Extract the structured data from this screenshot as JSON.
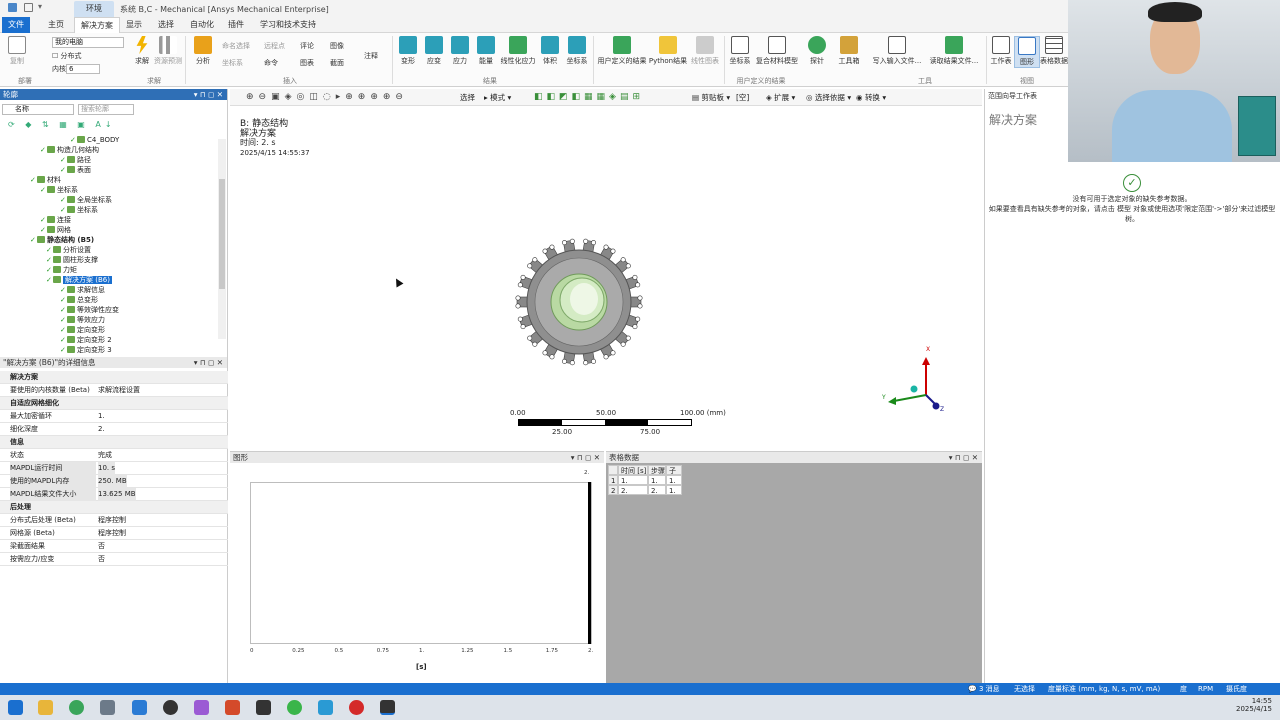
{
  "window": {
    "title": "系统 B,C - Mechanical [Ansys Mechanical Enterprise]",
    "context_tab": "环境"
  },
  "menu": [
    "文件",
    "主页",
    "解决方案",
    "显示",
    "选择",
    "自动化",
    "插件",
    "学习和技术支持"
  ],
  "ribbon": {
    "deploy": {
      "combo": "我的电脑",
      "distributed": "分布式",
      "cores_label": "内核",
      "cores_value": "6",
      "copy": "复制"
    },
    "solve_label": "求解",
    "resource_pred": "资源预测",
    "analysis": "分析",
    "insert_items": [
      "命名选择",
      "远程点",
      "评论",
      "图像",
      "注释",
      "坐标系",
      "命令",
      "图表",
      "截面"
    ],
    "results": [
      "变形",
      "应变",
      "应力",
      "能量",
      "线性化应力",
      "体积",
      "坐标系"
    ],
    "user_results": [
      "用户定义的结果",
      "Python结果",
      "线性图表"
    ],
    "tools": [
      "坐标系",
      "复合材料模型",
      "探针",
      "工具箱",
      "写入输入文件...",
      "读取结果文件..."
    ],
    "view": [
      "工作表",
      "图形",
      "表格数据"
    ],
    "groups": [
      "部署",
      "求解",
      "插入",
      "结果",
      "用户定义的结果",
      "工具",
      "视图"
    ]
  },
  "outline": {
    "title": "轮廓",
    "name_label": "名称",
    "search_placeholder": "搜索轮廓",
    "items": [
      "C4_BODY",
      "构造几何结构",
      "路径",
      "表面",
      "材料",
      "坐标系",
      "全局坐标系",
      "坐标系",
      "连接",
      "网格",
      "静态结构 (B5)",
      "分析设置",
      "圆柱形支撑",
      "力矩",
      "解决方案 (B6)",
      "求解信息",
      "总变形",
      "等效弹性应变",
      "等效应力",
      "定向变形",
      "定向变形 2",
      "定向变形 3"
    ]
  },
  "details": {
    "title": "\"解决方案 (B6)\"的详细信息",
    "rows": [
      {
        "type": "cat",
        "k": "解决方案"
      },
      {
        "k": "要使用的内核数量 (Beta)",
        "v": "求解流程设置"
      },
      {
        "type": "cat",
        "k": "自适应网格细化"
      },
      {
        "k": "最大加密循环",
        "v": "1."
      },
      {
        "k": "细化深度",
        "v": "2."
      },
      {
        "type": "cat",
        "k": "信息"
      },
      {
        "k": "状态",
        "v": "完成"
      },
      {
        "k": "MAPDL运行时间",
        "v": "10. s",
        "grey": true
      },
      {
        "k": "使用的MAPDL内存",
        "v": "250. MB",
        "grey": true
      },
      {
        "k": "MAPDL结果文件大小",
        "v": "13.625 MB",
        "grey": true
      },
      {
        "type": "cat",
        "k": "后处理"
      },
      {
        "k": "分布式后处理 (Beta)",
        "v": "程序控制"
      },
      {
        "k": "网格源 (Beta)",
        "v": "程序控制"
      },
      {
        "k": "梁截面结果",
        "v": "否"
      },
      {
        "k": "按需应力/应变",
        "v": "否"
      }
    ]
  },
  "viewport": {
    "toolbar": [
      "选择",
      "模式",
      "剪贴板",
      "[空]",
      "扩展",
      "选择依据",
      "转换"
    ],
    "header_title": "B: 静态结构",
    "header_sub": "解决方案",
    "header_time": "时间: 2. s",
    "header_date": "2025/4/15 14:55:37",
    "scale_top": [
      "0.00",
      "50.00",
      "100.00 (mm)"
    ],
    "scale_bottom": [
      "25.00",
      "75.00"
    ],
    "triad": [
      "X",
      "Y",
      "Z"
    ]
  },
  "graph": {
    "title": "图形",
    "xticks": [
      "0",
      "0.25",
      "0.5",
      "0.75",
      "1.",
      "1.25",
      "1.5",
      "1.75",
      "2."
    ],
    "xlabel": "[s]",
    "corner_tick": "2."
  },
  "tabular": {
    "title": "表格数据",
    "headers": [
      "时间 [s]",
      "步骤",
      "子步"
    ],
    "rows": [
      [
        "1",
        "1.",
        "1.",
        "1."
      ],
      [
        "2",
        "2.",
        "2.",
        "1."
      ]
    ]
  },
  "scope_panel": {
    "title": "范围向导工作表",
    "heading": "解决方案",
    "msg1": "没有可用于选定对象的缺失参考数据。",
    "msg2": "如果要查看具有缺失参考的对象，请点击 模型 对象或使用选项'限定范围'->'部分'来过滤模型树。"
  },
  "status": {
    "messages": "3 消息",
    "selection": "无选择",
    "units": "度量标准 (mm, kg, N, s, mV, mA)",
    "deg": "度",
    "rpm": "RPM",
    "temp": "摄氏度"
  },
  "clock": {
    "time": "14:55",
    "date": "2025/4/15"
  },
  "colors": {
    "accent": "#1a6fcf",
    "panel_head": "#2f6fb6"
  }
}
